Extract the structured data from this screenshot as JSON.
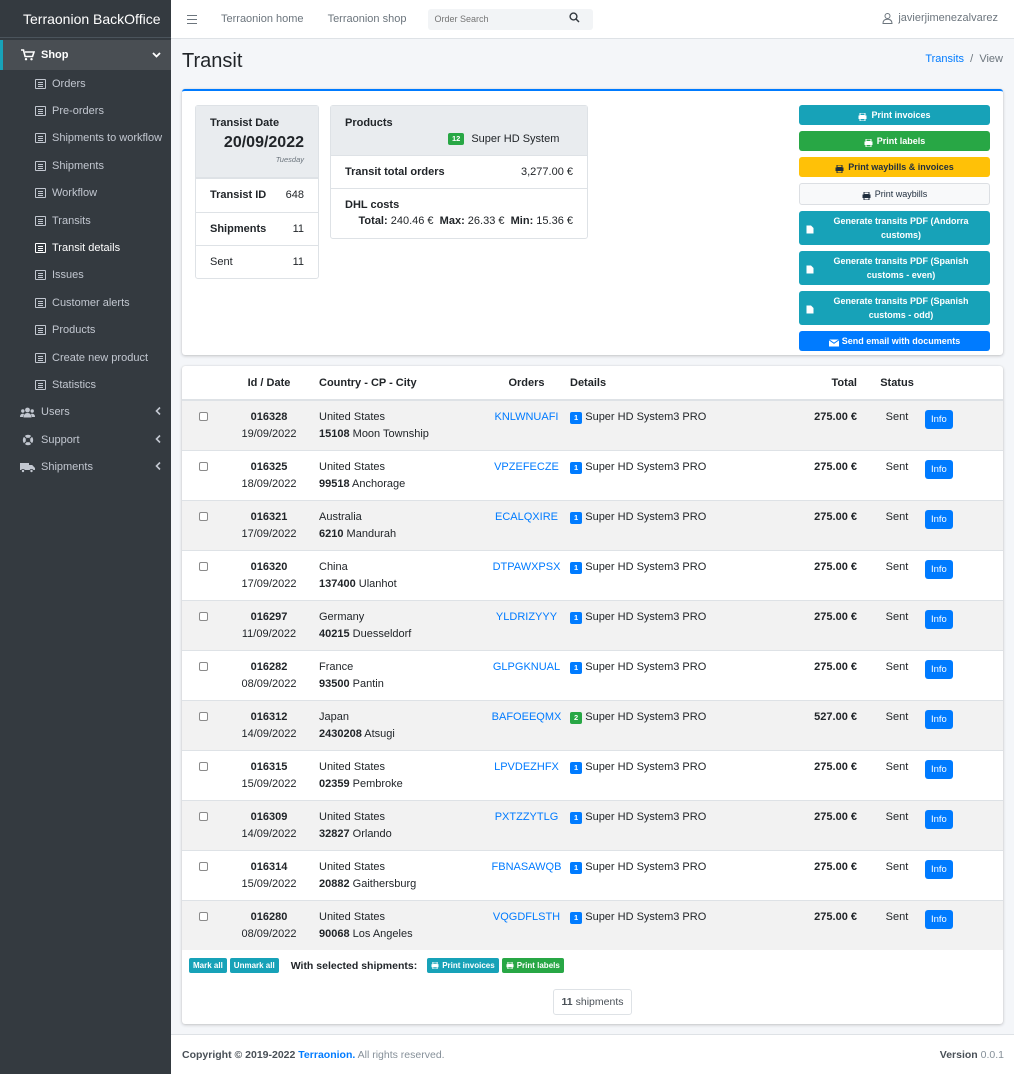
{
  "brand": "Terraonion BackOffice",
  "sidebar": {
    "shop_label": "Shop",
    "sub_items": [
      "Orders",
      "Pre-orders",
      "Shipments to workflow",
      "Shipments",
      "Workflow",
      "Transits",
      "Transit details",
      "Issues",
      "Customer alerts",
      "Products",
      "Create new product",
      "Statistics"
    ],
    "users_label": "Users",
    "support_label": "Support",
    "shipments_label": "Shipments"
  },
  "topnav": {
    "home": "Terraonion home",
    "shop": "Terraonion shop",
    "search_placeholder": "Order Search",
    "user": "javierjimenezalvarez"
  },
  "page": {
    "title": "Transit",
    "breadcrumb_link": "Transits",
    "breadcrumb_current": "View"
  },
  "summary": {
    "date_label": "Transist Date",
    "date": "20/09/2022",
    "weekday": "Tuesday",
    "id_label": "Transist ID",
    "id": "648",
    "shipments_label": "Shipments",
    "shipments": "11",
    "sent_label": "Sent",
    "sent": "11",
    "products_label": "Products",
    "product_qty": "12",
    "product_name": "Super HD System",
    "total_orders_label": "Transit total orders",
    "total_orders": "3,277.00 €",
    "dhl_label": "DHL costs",
    "total_label": "Total:",
    "total": "240.46 €",
    "max_label": "Max:",
    "max": "26.33 €",
    "min_label": "Min:",
    "min": "15.36 €"
  },
  "actions": {
    "print_invoices": "Print invoices",
    "print_labels": "Print labels",
    "print_waybills_invoices": "Print waybills & invoices",
    "print_waybills": "Print waybills",
    "pdf_andorra": "Generate transits PDF (Andorra customs)",
    "pdf_spanish_even": "Generate transits PDF (Spanish customs - even)",
    "pdf_spanish_odd": "Generate transits PDF (Spanish customs - odd)",
    "send_email": "Send email with documents"
  },
  "table": {
    "headers": {
      "id_date": "Id / Date",
      "country": "Country - CP - City",
      "orders": "Orders",
      "details": "Details",
      "total": "Total",
      "status": "Status"
    },
    "info_label": "Info",
    "rows": [
      {
        "id": "016328",
        "date": "19/09/2022",
        "country": "United States",
        "cp": "15108",
        "city": "Moon Township",
        "order": "KNLWNUAFI",
        "qty": "1",
        "product": "Super HD System3 PRO",
        "total": "275.00 €",
        "status": "Sent"
      },
      {
        "id": "016325",
        "date": "18/09/2022",
        "country": "United States",
        "cp": "99518",
        "city": "Anchorage",
        "order": "VPZEFECZE",
        "qty": "1",
        "product": "Super HD System3 PRO",
        "total": "275.00 €",
        "status": "Sent"
      },
      {
        "id": "016321",
        "date": "17/09/2022",
        "country": "Australia",
        "cp": "6210",
        "city": "Mandurah",
        "order": "ECALQXIRE",
        "qty": "1",
        "product": "Super HD System3 PRO",
        "total": "275.00 €",
        "status": "Sent"
      },
      {
        "id": "016320",
        "date": "17/09/2022",
        "country": "China",
        "cp": "137400",
        "city": "Ulanhot",
        "order": "DTPAWXPSX",
        "qty": "1",
        "product": "Super HD System3 PRO",
        "total": "275.00 €",
        "status": "Sent"
      },
      {
        "id": "016297",
        "date": "11/09/2022",
        "country": "Germany",
        "cp": "40215",
        "city": "Duesseldorf",
        "order": "YLDRIZYYY",
        "qty": "1",
        "product": "Super HD System3 PRO",
        "total": "275.00 €",
        "status": "Sent"
      },
      {
        "id": "016282",
        "date": "08/09/2022",
        "country": "France",
        "cp": "93500",
        "city": "Pantin",
        "order": "GLPGKNUAL",
        "qty": "1",
        "product": "Super HD System3 PRO",
        "total": "275.00 €",
        "status": "Sent"
      },
      {
        "id": "016312",
        "date": "14/09/2022",
        "country": "Japan",
        "cp": "2430208",
        "city": "Atsugi",
        "order": "BAFOEEQMX",
        "qty": "2",
        "product": "Super HD System3 PRO",
        "total": "527.00 €",
        "status": "Sent"
      },
      {
        "id": "016315",
        "date": "15/09/2022",
        "country": "United States",
        "cp": "02359",
        "city": "Pembroke",
        "order": "LPVDEZHFX",
        "qty": "1",
        "product": "Super HD System3 PRO",
        "total": "275.00 €",
        "status": "Sent"
      },
      {
        "id": "016309",
        "date": "14/09/2022",
        "country": "United States",
        "cp": "32827",
        "city": "Orlando",
        "order": "PXTZZYTLG",
        "qty": "1",
        "product": "Super HD System3 PRO",
        "total": "275.00 €",
        "status": "Sent"
      },
      {
        "id": "016314",
        "date": "15/09/2022",
        "country": "United States",
        "cp": "20882",
        "city": "Gaithersburg",
        "order": "FBNASAWQB",
        "qty": "1",
        "product": "Super HD System3 PRO",
        "total": "275.00 €",
        "status": "Sent"
      },
      {
        "id": "016280",
        "date": "08/09/2022",
        "country": "United States",
        "cp": "90068",
        "city": "Los Angeles",
        "order": "VQGDFLSTH",
        "qty": "1",
        "product": "Super HD System3 PRO",
        "total": "275.00 €",
        "status": "Sent"
      }
    ]
  },
  "bulk": {
    "mark_all": "Mark all",
    "unmark_all": "Unmark all",
    "with_selected": "With selected shipments:",
    "print_invoices": "Print invoices",
    "print_labels": "Print labels",
    "count": "11",
    "count_label": "shipments"
  },
  "footer": {
    "copyright": "Copyright © 2019-2022",
    "company": "Terraonion.",
    "rights": "All rights reserved.",
    "version_label": "Version",
    "version": "0.0.1"
  },
  "colors": {
    "sidebar": "#343a40",
    "primary": "#007bff",
    "info": "#17a2b8",
    "success": "#28a745",
    "warning": "#ffc107"
  }
}
